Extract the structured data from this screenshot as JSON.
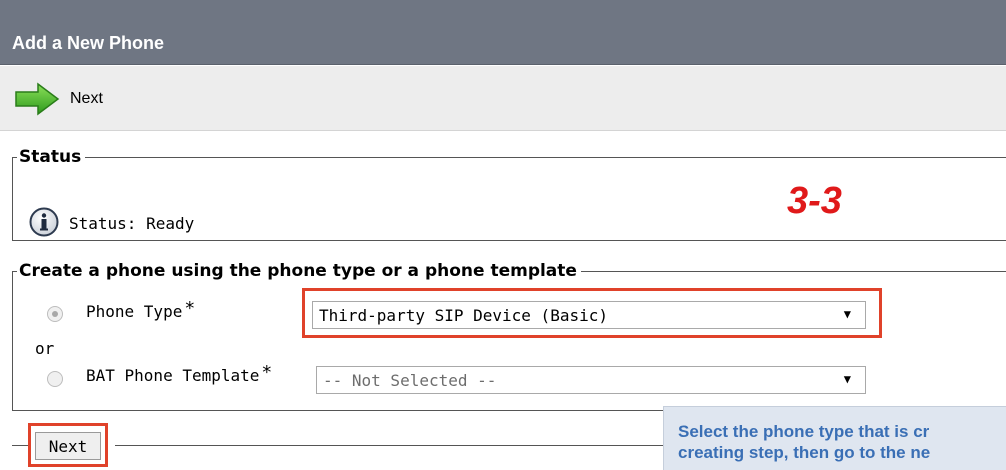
{
  "header": {
    "title": "Add a New Phone"
  },
  "toolbar": {
    "next_label": "Next",
    "next_icon": "green-arrow-right-icon"
  },
  "status": {
    "legend": "Status",
    "icon": "info-icon",
    "text": "Status: Ready"
  },
  "annotation": {
    "step": "3-3",
    "color": "#e0191a"
  },
  "create": {
    "legend": "Create a phone using the phone type or a phone template",
    "phone_type_label": "Phone Type",
    "required_mark": "*",
    "phone_type_value": "Third-party SIP Device (Basic)",
    "or_text": "or",
    "bat_label": "BAT Phone Template",
    "bat_value": "-- Not Selected --",
    "selected_option": "Phone Type"
  },
  "footer": {
    "next_label": "Next"
  },
  "tooltip": {
    "line1": "Select the phone type that is cr",
    "line2": "creating step, then go to the ne"
  },
  "colors": {
    "titlebar": "#6f7683",
    "toolbar": "#ededed",
    "highlight": "#e0422a",
    "tooltip_text": "#3a6fb5",
    "tooltip_bg": "#dfe6f0"
  }
}
